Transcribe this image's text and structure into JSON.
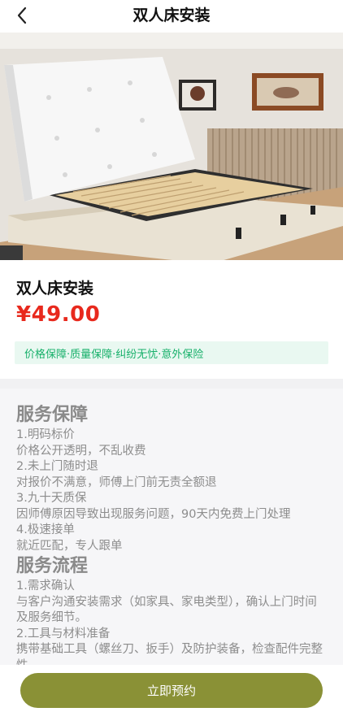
{
  "header": {
    "title": "双人床安装",
    "back_icon": "chevron-left-icon"
  },
  "hero": {
    "image_desc": "bed-frame-photo"
  },
  "product": {
    "name": "双人床安装",
    "price": "¥49.00",
    "guarantee": "价格保障·质量保障·纠纷无忧·意外保险"
  },
  "details": {
    "section1_title": "服务保障",
    "s1_l1": "1.明码标价",
    "s1_l2": "价格公开透明，不乱收费",
    "s1_l3": "2.未上门随时退",
    "s1_l4": "对报价不满意，师傅上门前无责全额退",
    "s1_l5": "3.九十天质保",
    "s1_l6": "因师傅原因导致出现服务问题，90天内免费上门处理",
    "s1_l7": "4.极速接单",
    "s1_l8": "就近匹配，专人跟单",
    "section2_title": "服务流程",
    "s2_l1": "1.需求确认",
    "s2_l2": "与客户沟通安装需求（如家具、家电类型），确认上门时间及服务细节。",
    "s2_l3": "2.工具与材料准备",
    "s2_l4": "携带基础工具（螺丝刀、扳手）及防护装备，检查配件完整性。"
  },
  "footer": {
    "book_label": "立即预约"
  },
  "colors": {
    "price": "#e8291d",
    "guarantee_text": "#17b06a",
    "guarantee_bg": "#e9f8f1",
    "button": "#8a9136"
  }
}
